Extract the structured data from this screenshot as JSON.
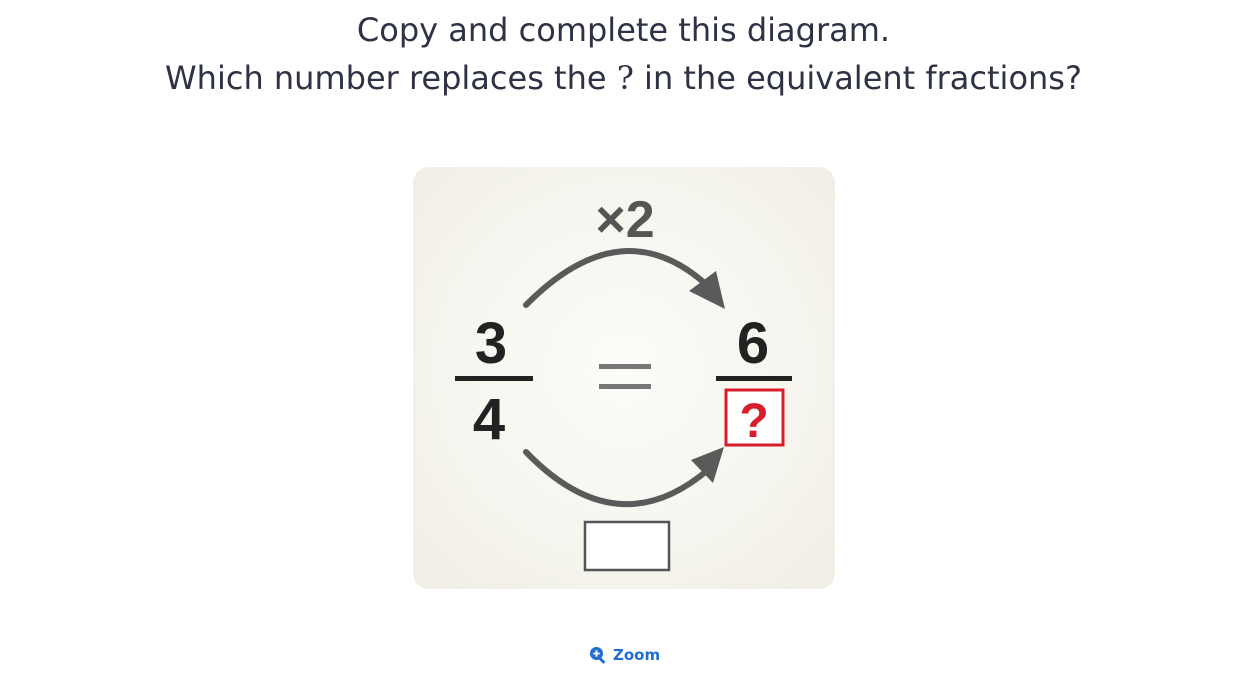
{
  "question": {
    "line1": "Copy and complete this diagram.",
    "line2_before": "Which number replaces the",
    "line2_mark": "?",
    "line2_after": "in the equivalent fractions?"
  },
  "diagram": {
    "multiplier_top": "×2",
    "fraction_left": {
      "numerator": "3",
      "denominator": "4"
    },
    "equals": "=",
    "fraction_right": {
      "numerator": "6",
      "denominator": "?"
    },
    "bottom_box_value": ""
  },
  "zoom": {
    "label": "Zoom",
    "icon": "zoom-in-icon"
  },
  "colors": {
    "text": "#2e3244",
    "number": "#222222",
    "arrow": "#5a5a5a",
    "unknown": "#d81e2a",
    "link": "#1f6fd0"
  }
}
